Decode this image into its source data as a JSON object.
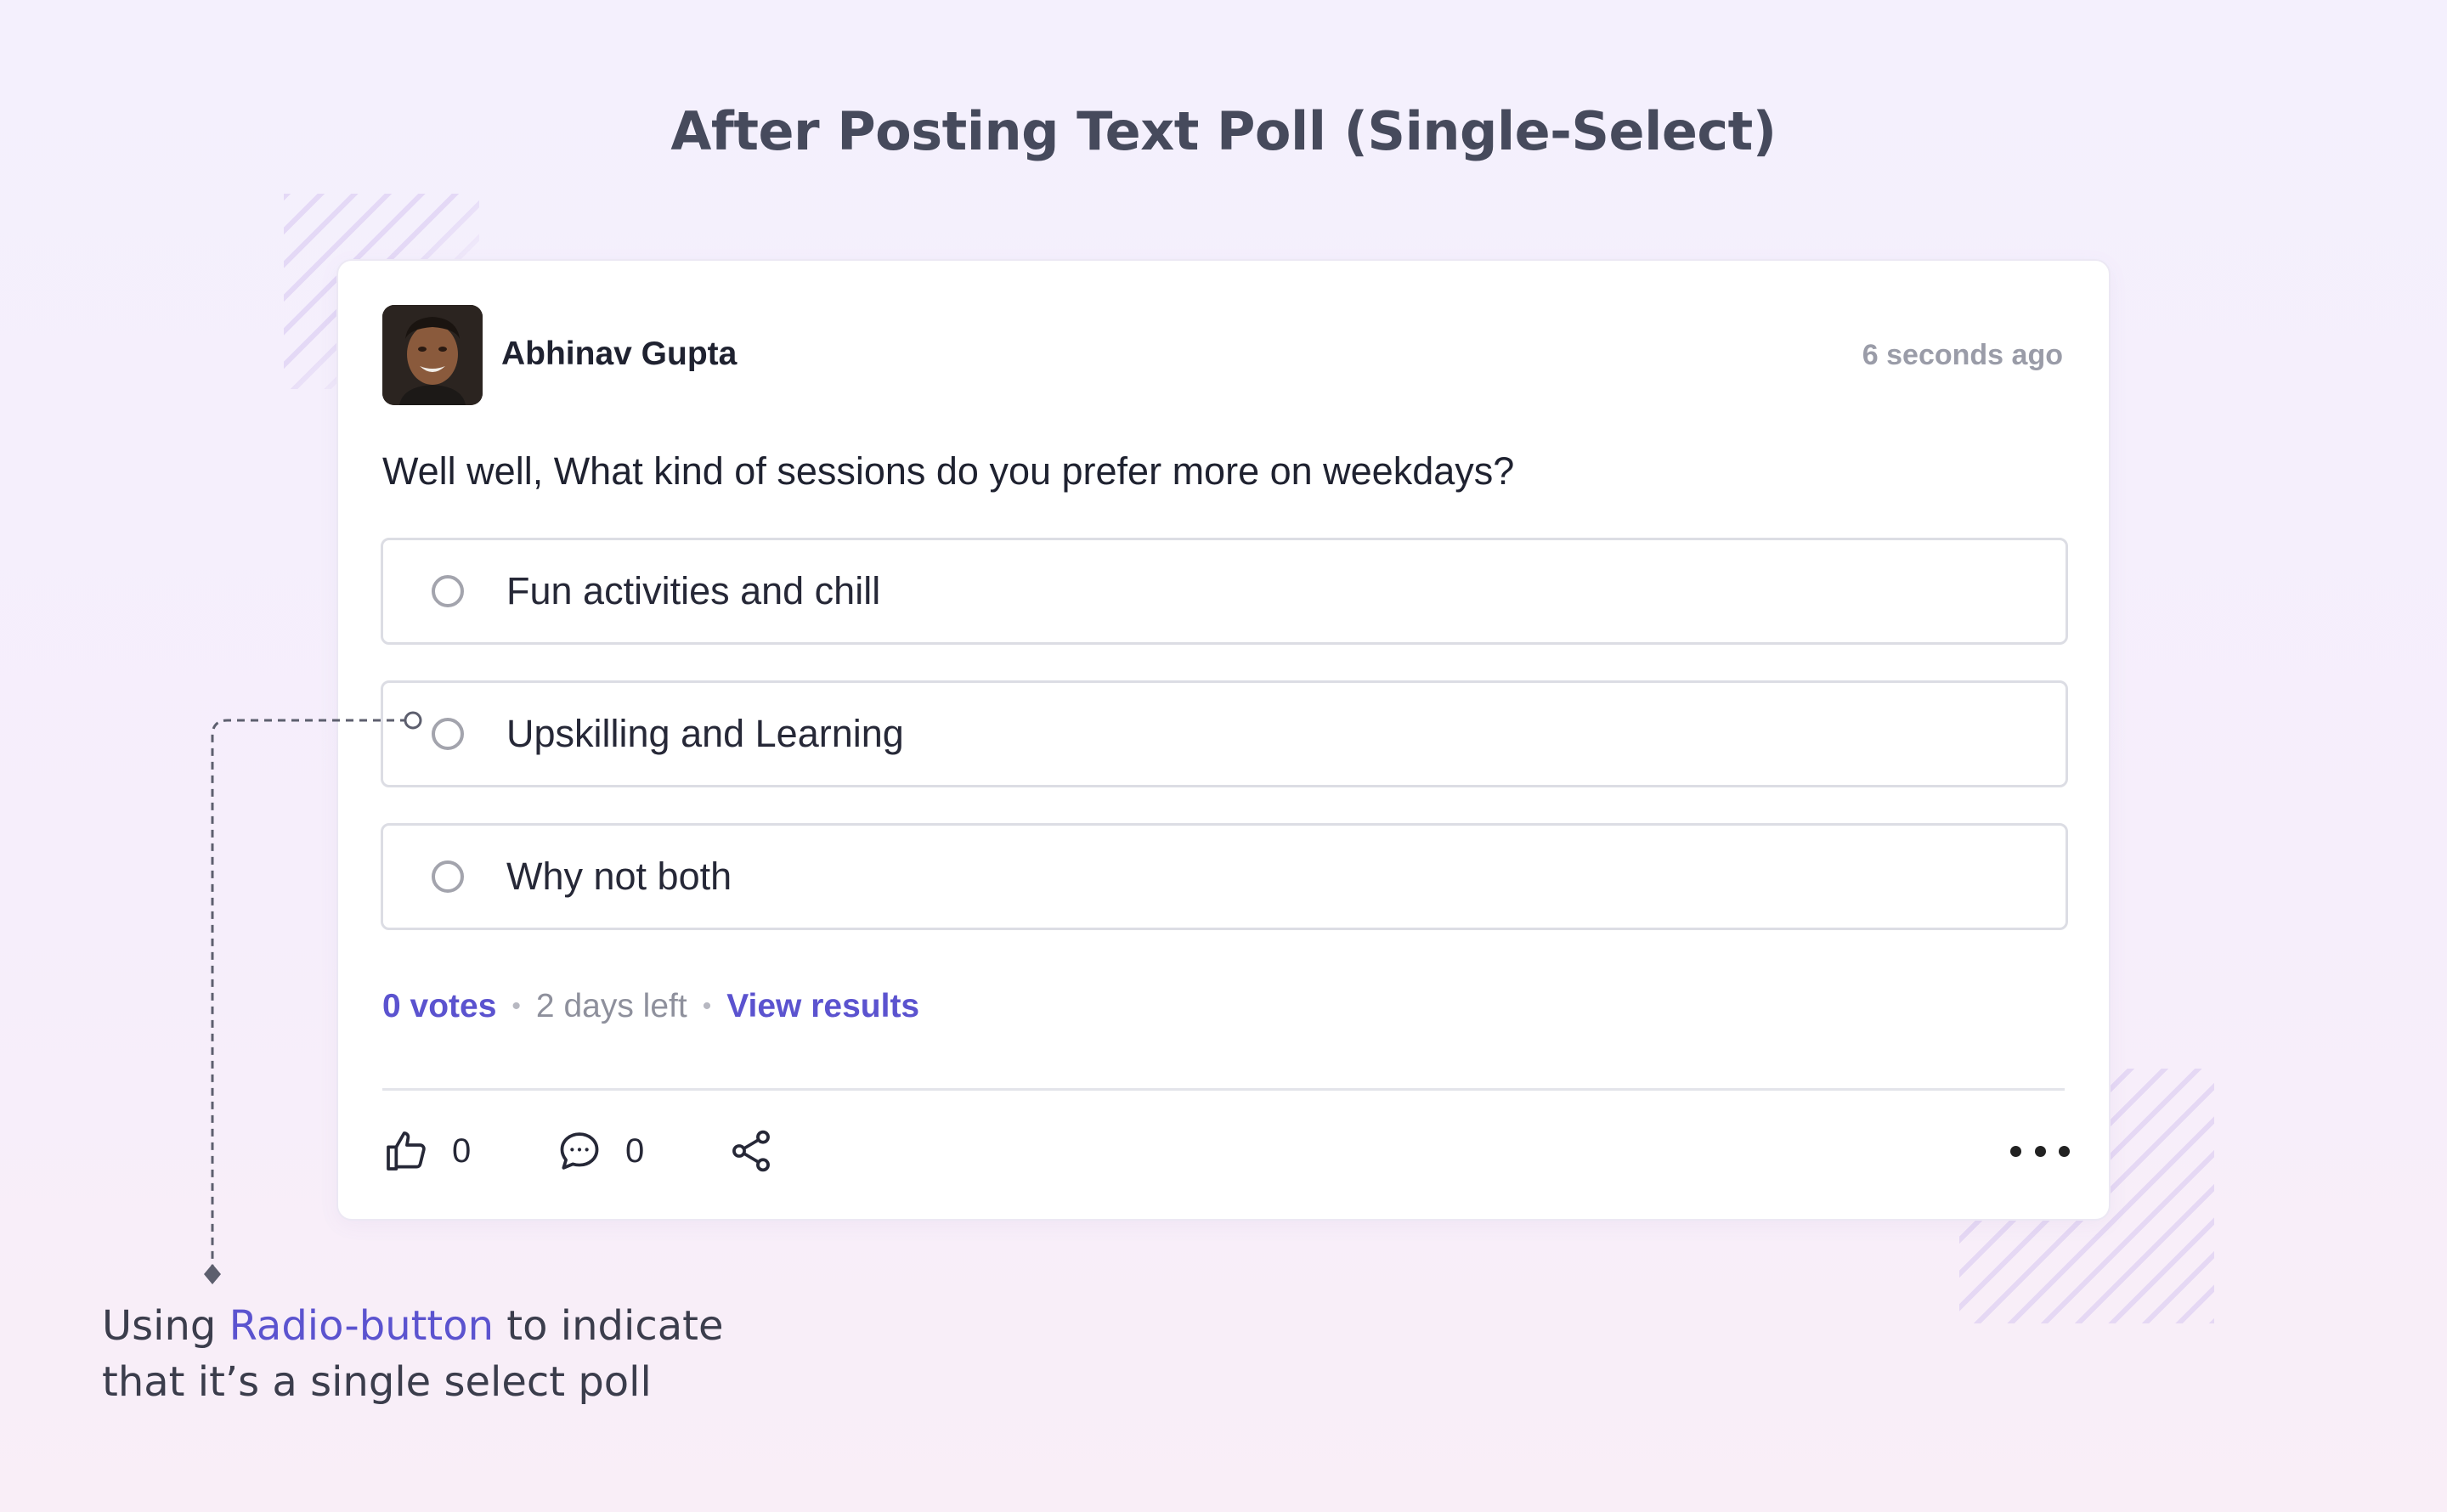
{
  "title": "After Posting Text Poll (Single-Select)",
  "post": {
    "author": "Abhinav Gupta",
    "timestamp": "6 seconds ago",
    "question": "Well well, What kind of sessions do you prefer more on weekdays?",
    "poll_type": "single-select",
    "options": [
      {
        "label": "Fun activities and chill",
        "selected": false
      },
      {
        "label": "Upskilling and Learning",
        "selected": false
      },
      {
        "label": "Why not both",
        "selected": false
      }
    ],
    "votes": "0 votes",
    "time_left": "2 days left",
    "view_results": "View results",
    "likes": "0",
    "comments": "0"
  },
  "annotation": {
    "prefix": "Using ",
    "highlight": "Radio-button",
    "suffix": " to indicate",
    "line2": "that it’s a single select poll"
  },
  "icons": [
    "avatar-photo",
    "radio-icon",
    "thumbs-up-icon",
    "comment-icon",
    "share-icon",
    "more-icon"
  ],
  "colors": {
    "accent": "#5b53cf",
    "text": "#1f2230",
    "muted": "#9a9ca8",
    "border": "#dcdde4"
  }
}
